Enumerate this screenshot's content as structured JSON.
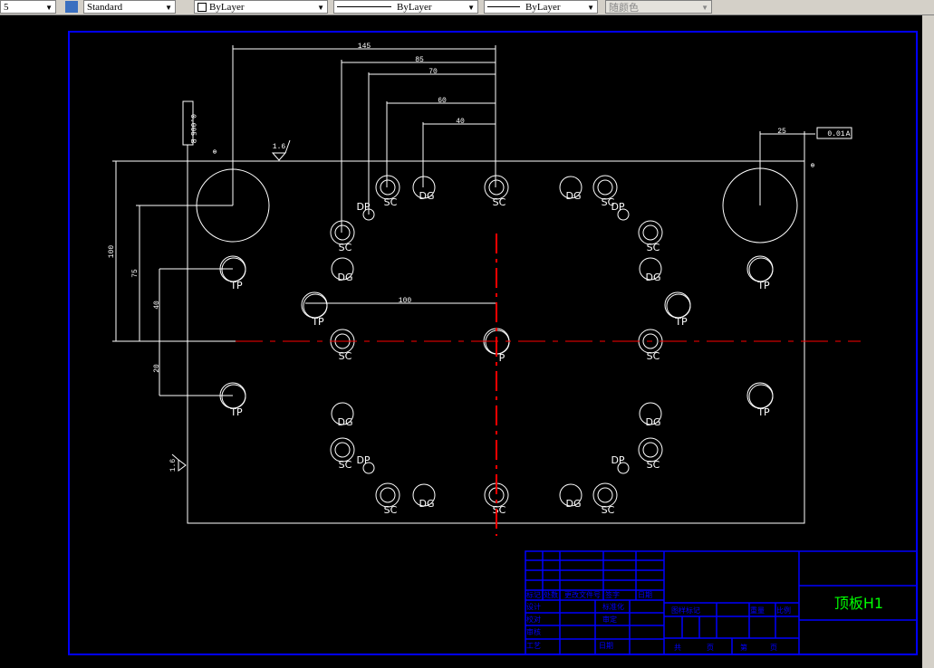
{
  "toolbar": {
    "layer_value": "5",
    "textstyle_value": "Standard",
    "color_value": "ByLayer",
    "linetype_value": "ByLayer",
    "lineweight_value": "ByLayer",
    "plotstyle_value": "随颜色"
  },
  "colors": {
    "frame": "#0000ff",
    "centerline": "#ff0000",
    "geometry": "#ffffff",
    "title": "#00ff00"
  },
  "drawing": {
    "dimensions": {
      "d145": "145",
      "d85": "85",
      "d70": "70",
      "d60": "60",
      "d40": "40",
      "d25": "25",
      "d100v": "100",
      "d75": "75",
      "d40v": "40",
      "d20": "20",
      "d100h": "100"
    },
    "roughness": "1.6",
    "tolerance_perp": "0.005",
    "datum_b": "B",
    "tolerance_pos": "0.01",
    "datum_a": "A",
    "holes": [
      "SC",
      "DG",
      "SC",
      "DG",
      "SC",
      "DP",
      "DP",
      "SC",
      "DG",
      "P",
      "TP",
      "SC",
      "TP",
      "SC",
      "DG",
      "TP",
      "TP",
      "SC",
      "TP",
      "DG",
      "SC",
      "DP",
      "SC",
      "DG",
      "SC",
      "DG",
      "SC",
      "DP",
      "SC",
      "DG",
      "TP",
      "TP",
      "SC",
      "DG"
    ]
  },
  "titleblock": {
    "r_mark": "标记",
    "r_count": "处数",
    "r_doc": "更改文件号",
    "r_sign": "签字",
    "r_date": "日期",
    "design": "设计",
    "standard": "标准化",
    "check": "校对",
    "review": "审定",
    "audit": "审核",
    "process": "工艺",
    "date": "日期",
    "sample_mark": "图样标记",
    "weight": "重量",
    "scale": "比例",
    "total": "共",
    "page": "页",
    "nth": "第",
    "page2": "页",
    "name": "顶板H1"
  }
}
